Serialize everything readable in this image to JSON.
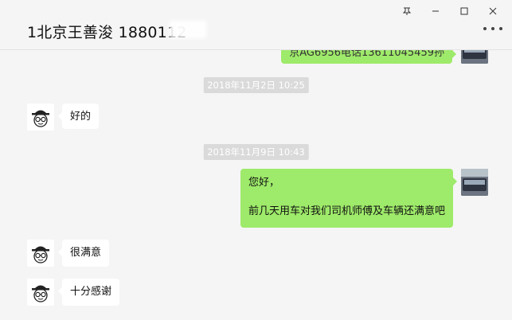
{
  "window": {
    "title": "1北京王善浚 1880112",
    "controls": {
      "pin": "pin-icon",
      "minimize": "minimize-icon",
      "maximize": "maximize-icon",
      "close": "close-icon"
    },
    "more_icon": "more-dots-icon"
  },
  "messages": [
    {
      "type": "sent",
      "text": "京AG6956电话13611045459孙",
      "clipped": true,
      "avatar": "bus-avatar"
    },
    {
      "type": "time",
      "text": "2018年11月2日 10:25"
    },
    {
      "type": "received",
      "text": "好的",
      "avatar": "hat-glasses-avatar"
    },
    {
      "type": "time",
      "text": "2018年11月9日 10:43"
    },
    {
      "type": "sent",
      "line1": "您好，",
      "line2": "前几天用车对我们司机师傅及车辆还满意吧",
      "avatar": "bus-avatar"
    },
    {
      "type": "received",
      "text": "很满意",
      "avatar": "hat-glasses-avatar"
    },
    {
      "type": "received",
      "text": "十分感谢",
      "avatar": "hat-glasses-avatar"
    }
  ],
  "colors": {
    "sent_bubble": "#9eea6a",
    "received_bubble": "#ffffff",
    "background": "#f5f5f5",
    "timestamp_bg": "#dadada"
  }
}
